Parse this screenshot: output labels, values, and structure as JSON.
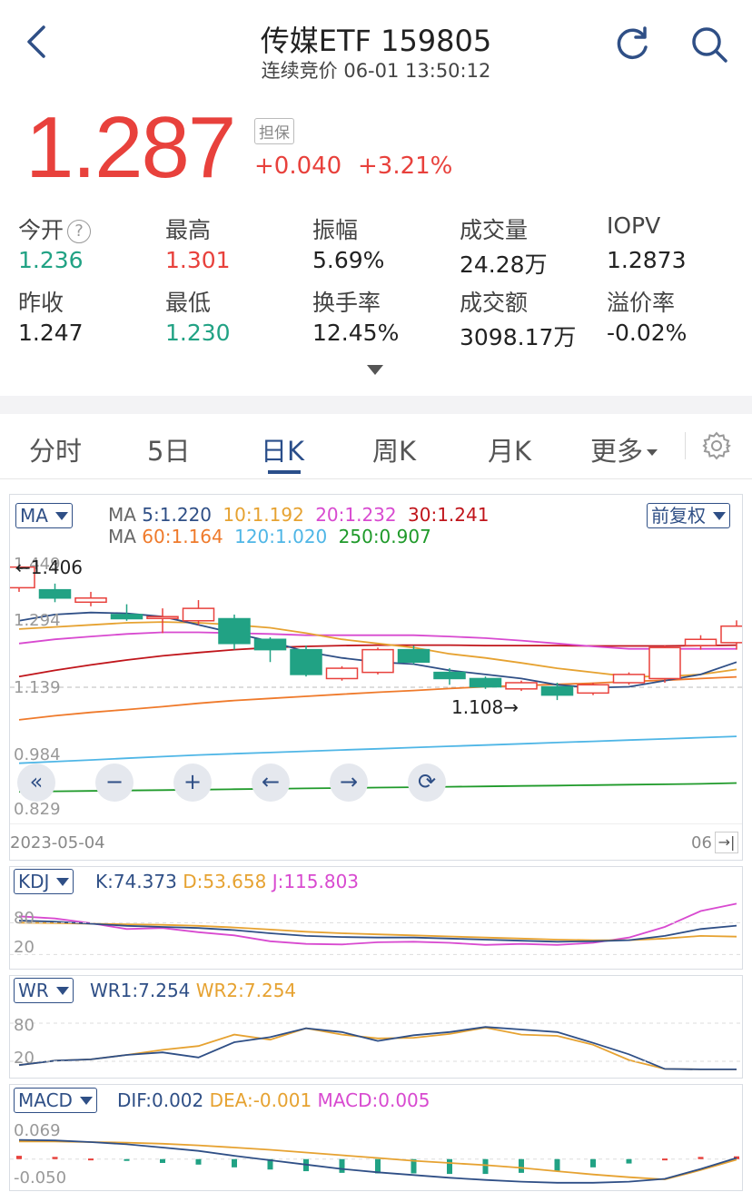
{
  "header": {
    "title": "传媒ETF 159805",
    "subtitle": "连续竞价 06-01 13:50:12",
    "icons": [
      "back-icon",
      "refresh-icon",
      "search-icon"
    ]
  },
  "quote": {
    "price": "1.287",
    "badge": "担保",
    "change": "+0.040",
    "change_pct": "+3.21%"
  },
  "stats": [
    {
      "label": "今开",
      "value": "1.236",
      "color": "#21a284",
      "help": "?"
    },
    {
      "label": "最高",
      "value": "1.301",
      "color": "#e8413c"
    },
    {
      "label": "振幅",
      "value": "5.69%",
      "color": "#222222"
    },
    {
      "label": "成交量",
      "value": "24.28万",
      "color": "#222222"
    },
    {
      "label": "IOPV",
      "value": "1.2873",
      "color": "#222222"
    },
    {
      "label": "昨收",
      "value": "1.247",
      "color": "#222222"
    },
    {
      "label": "最低",
      "value": "1.230",
      "color": "#21a284"
    },
    {
      "label": "换手率",
      "value": "12.45%",
      "color": "#222222"
    },
    {
      "label": "成交额",
      "value": "3098.17万",
      "color": "#222222"
    },
    {
      "label": "溢价率",
      "value": "-0.02%",
      "color": "#222222"
    }
  ],
  "tabs": [
    "分时",
    "5日",
    "日K",
    "周K",
    "月K",
    "更多"
  ],
  "active_tab": "日K",
  "main_chart": {
    "indicator": "MA",
    "adjust": "前复权",
    "ma_row1": {
      "prefix": "MA",
      "items": [
        "5:1.220",
        "10:1.192",
        "20:1.232",
        "30:1.241"
      ]
    },
    "ma_row2": {
      "prefix": "MA",
      "items": [
        "60:1.164",
        "120:1.020",
        "250:0.907"
      ]
    },
    "y_ticks": [
      "1.449",
      "1.294",
      "1.139",
      "0.984",
      "0.829"
    ],
    "high_marker": "←1.406",
    "low_marker": "1.108→",
    "date_start": "2023-05-04",
    "date_end": "06",
    "controls": [
      "fast-back-icon",
      "zoom-out-icon",
      "zoom-in-icon",
      "left-arrow-icon",
      "right-arrow-icon",
      "rotate-icon"
    ]
  },
  "kdj": {
    "indicator": "KDJ",
    "K": "K:74.373",
    "D": "D:53.658",
    "J": "J:115.803",
    "y_ticks": [
      "80",
      "20"
    ]
  },
  "wr": {
    "indicator": "WR",
    "WR1": "WR1:7.254",
    "WR2": "WR2:7.254",
    "y_ticks": [
      "80",
      "20"
    ]
  },
  "macd": {
    "indicator": "MACD",
    "DIF": "DIF:0.002",
    "DEA": "DEA:-0.001",
    "MACD": "MACD:0.005",
    "y_ticks": [
      "0.069",
      "-0.050"
    ]
  },
  "colors": {
    "up": "#e8413c",
    "down": "#21a284",
    "ma5": "#2f4f86",
    "ma10": "#e6a231",
    "ma20": "#d84ad0",
    "ma30": "#c0151b",
    "ma60": "#ef7a2b",
    "ma120": "#4fb6e6",
    "ma250": "#1f9a2a"
  },
  "chart_data": {
    "type": "candlestick",
    "y_range": [
      0.829,
      1.449
    ],
    "candles": [
      {
        "o": 1.38,
        "c": 1.43,
        "h": 1.44,
        "l": 1.37
      },
      {
        "o": 1.375,
        "c": 1.355,
        "h": 1.39,
        "l": 1.345
      },
      {
        "o": 1.345,
        "c": 1.355,
        "h": 1.37,
        "l": 1.335
      },
      {
        "o": 1.315,
        "c": 1.305,
        "h": 1.34,
        "l": 1.3
      },
      {
        "o": 1.31,
        "c": 1.31,
        "h": 1.33,
        "l": 1.27
      },
      {
        "o": 1.3,
        "c": 1.33,
        "h": 1.35,
        "l": 1.29
      },
      {
        "o": 1.305,
        "c": 1.245,
        "h": 1.315,
        "l": 1.23
      },
      {
        "o": 1.255,
        "c": 1.23,
        "h": 1.26,
        "l": 1.2
      },
      {
        "o": 1.23,
        "c": 1.17,
        "h": 1.24,
        "l": 1.165
      },
      {
        "o": 1.16,
        "c": 1.185,
        "h": 1.19,
        "l": 1.155
      },
      {
        "o": 1.175,
        "c": 1.23,
        "h": 1.235,
        "l": 1.17
      },
      {
        "o": 1.23,
        "c": 1.2,
        "h": 1.24,
        "l": 1.195
      },
      {
        "o": 1.175,
        "c": 1.16,
        "h": 1.185,
        "l": 1.145
      },
      {
        "o": 1.16,
        "c": 1.14,
        "h": 1.165,
        "l": 1.135
      },
      {
        "o": 1.135,
        "c": 1.15,
        "h": 1.155,
        "l": 1.13
      },
      {
        "o": 1.14,
        "c": 1.12,
        "h": 1.15,
        "l": 1.108
      },
      {
        "o": 1.125,
        "c": 1.145,
        "h": 1.15,
        "l": 1.12
      },
      {
        "o": 1.15,
        "c": 1.17,
        "h": 1.175,
        "l": 1.145
      },
      {
        "o": 1.16,
        "c": 1.235,
        "h": 1.24,
        "l": 1.15
      },
      {
        "o": 1.24,
        "c": 1.255,
        "h": 1.265,
        "l": 1.23
      },
      {
        "o": 1.247,
        "c": 1.287,
        "h": 1.301,
        "l": 1.23
      }
    ],
    "ma5": [
      1.3,
      1.315,
      1.32,
      1.318,
      1.31,
      1.29,
      1.27,
      1.25,
      1.225,
      1.21,
      1.2,
      1.195,
      1.18,
      1.17,
      1.16,
      1.145,
      1.138,
      1.14,
      1.155,
      1.17,
      1.2
    ],
    "ma10": [
      1.28,
      1.285,
      1.29,
      1.295,
      1.297,
      1.295,
      1.29,
      1.283,
      1.27,
      1.255,
      1.245,
      1.235,
      1.22,
      1.21,
      1.198,
      1.185,
      1.175,
      1.165,
      1.165,
      1.17,
      1.182
    ],
    "ma20": [
      1.245,
      1.255,
      1.262,
      1.268,
      1.272,
      1.272,
      1.27,
      1.268,
      1.265,
      1.265,
      1.265,
      1.265,
      1.262,
      1.258,
      1.252,
      1.245,
      1.238,
      1.232,
      1.232,
      1.232,
      1.232
    ],
    "ma30": [
      1.165,
      1.18,
      1.193,
      1.205,
      1.215,
      1.223,
      1.23,
      1.235,
      1.238,
      1.24,
      1.241,
      1.241,
      1.241,
      1.24,
      1.24,
      1.24,
      1.239,
      1.239,
      1.239,
      1.24,
      1.241
    ],
    "ma60": [
      1.06,
      1.07,
      1.078,
      1.085,
      1.092,
      1.1,
      1.107,
      1.112,
      1.117,
      1.122,
      1.127,
      1.131,
      1.136,
      1.14,
      1.143,
      1.146,
      1.149,
      1.153,
      1.156,
      1.16,
      1.164
    ],
    "ma120": [
      0.955,
      0.959,
      0.963,
      0.967,
      0.971,
      0.975,
      0.978,
      0.981,
      0.984,
      0.987,
      0.99,
      0.993,
      0.996,
      0.999,
      1.002,
      1.005,
      1.008,
      1.011,
      1.014,
      1.017,
      1.02
    ],
    "ma250": [
      0.886,
      0.887,
      0.888,
      0.889,
      0.89,
      0.891,
      0.892,
      0.893,
      0.894,
      0.895,
      0.896,
      0.897,
      0.898,
      0.899,
      0.9,
      0.901,
      0.902,
      0.903,
      0.904,
      0.905,
      0.907
    ],
    "kdj_range": [
      0,
      120
    ],
    "K": [
      84,
      82,
      78,
      74,
      72,
      70,
      66,
      60,
      55,
      53,
      52,
      52,
      50,
      48,
      46,
      44,
      45,
      47,
      55,
      68,
      74.373
    ],
    "D": [
      80,
      79,
      78,
      77,
      76,
      74,
      71,
      67,
      63,
      60,
      58,
      56,
      54,
      52,
      50,
      48,
      47,
      47,
      50,
      55,
      53.658
    ],
    "J": [
      92,
      88,
      79,
      68,
      70,
      62,
      56,
      45,
      40,
      39,
      43,
      44,
      42,
      38,
      40,
      38,
      42,
      52,
      72,
      102,
      115.803
    ],
    "wr_range": [
      0,
      100
    ],
    "WR1": [
      14,
      21,
      23,
      30,
      34,
      26,
      50,
      58,
      72,
      66,
      52,
      61,
      66,
      74,
      70,
      66,
      49,
      31,
      8,
      7.254,
      7.254
    ],
    "WR2": [
      14,
      21,
      23,
      30,
      38,
      44,
      62,
      54,
      72,
      62,
      56,
      57,
      63,
      73,
      62,
      60,
      46,
      22,
      8,
      7.254,
      7.254
    ],
    "macd_range": [
      -0.05,
      0.069
    ],
    "DIF": [
      0.035,
      0.034,
      0.031,
      0.027,
      0.021,
      0.015,
      0.006,
      -0.002,
      -0.01,
      -0.018,
      -0.024,
      -0.029,
      -0.034,
      -0.038,
      -0.041,
      -0.043,
      -0.043,
      -0.041,
      -0.036,
      -0.018,
      0.002
    ],
    "DEA": [
      0.032,
      0.032,
      0.031,
      0.03,
      0.028,
      0.025,
      0.021,
      0.017,
      0.012,
      0.007,
      0.002,
      -0.003,
      -0.007,
      -0.011,
      -0.016,
      -0.022,
      -0.028,
      -0.033,
      -0.037,
      -0.02,
      -0.001
    ],
    "MACD": [
      0.006,
      0.004,
      0.001,
      -0.003,
      -0.007,
      -0.01,
      -0.015,
      -0.019,
      -0.022,
      -0.025,
      -0.026,
      -0.026,
      -0.027,
      -0.027,
      -0.025,
      -0.021,
      -0.015,
      -0.008,
      0.001,
      0.004,
      0.005
    ]
  }
}
